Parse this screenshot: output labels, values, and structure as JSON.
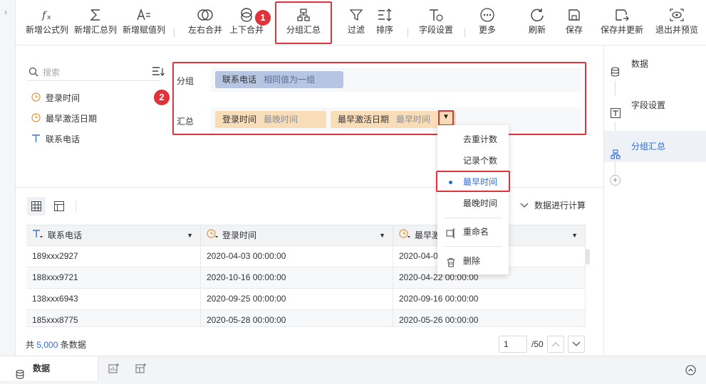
{
  "toolbar": {
    "new_formula_col": "新增公式列",
    "new_summary_col": "新增汇总列",
    "new_assign_col": "新增赋值列",
    "left_right_merge": "左右合并",
    "up_down_merge": "上下合并",
    "group_summary": "分组汇总",
    "filter": "过滤",
    "sort": "排序",
    "field_settings": "字段设置",
    "more": "更多",
    "refresh": "刷新",
    "save": "保存",
    "save_update": "保存并更新",
    "exit_preview": "退出并预览",
    "badge_1": "1"
  },
  "fields": {
    "search_placeholder": "搜索",
    "items": [
      {
        "label": "登录时间",
        "icon": "clock-icon"
      },
      {
        "label": "最早激活日期",
        "icon": "clock-icon"
      },
      {
        "label": "联系电话",
        "icon": "text-type-icon"
      }
    ]
  },
  "group_config": {
    "badge_2": "2",
    "group_label": "分组",
    "group_chip": {
      "field": "联系电话",
      "method": "相同值为一组"
    },
    "summary_label": "汇总",
    "summary_chips": [
      {
        "field": "登录时间",
        "method": "最晚时间"
      },
      {
        "field": "最早激活日期",
        "method": "最早时间"
      }
    ]
  },
  "dropdown": {
    "items": [
      "去重计数",
      "记录个数",
      "最早时间",
      "最晚时间"
    ],
    "selected": "最早时间",
    "rename": "重命名",
    "delete": "删除"
  },
  "data_view": {
    "calc_label": "数据进行计算",
    "columns": [
      "联系电话",
      "登录时间",
      "最早激"
    ],
    "rows": [
      [
        "189xxx2927",
        "2020-04-03 00:00:00",
        "2020-04-02"
      ],
      [
        "188xxx9721",
        "2020-10-16 00:00:00",
        "2020-04-22 00:00:00"
      ],
      [
        "138xxx6943",
        "2020-09-25 00:00:00",
        "2020-09-16 00:00:00"
      ],
      [
        "185xxx8775",
        "2020-05-28 00:00:00",
        "2020-05-26 00:00:00"
      ]
    ],
    "total_prefix": "共",
    "total_count": "5,000",
    "total_suffix": "条数据",
    "page_current": "1",
    "page_total": "/50"
  },
  "right_panel": {
    "items": [
      "数据",
      "字段设置",
      "分组汇总"
    ],
    "active": "分组汇总"
  },
  "bottom_bar": {
    "sheet_tab": "数据"
  },
  "colors": {
    "accent": "#2f6bd8",
    "highlight": "#e0323a",
    "group_chip": "#b6c6e2",
    "summary_chip": "#f9dcb8"
  }
}
